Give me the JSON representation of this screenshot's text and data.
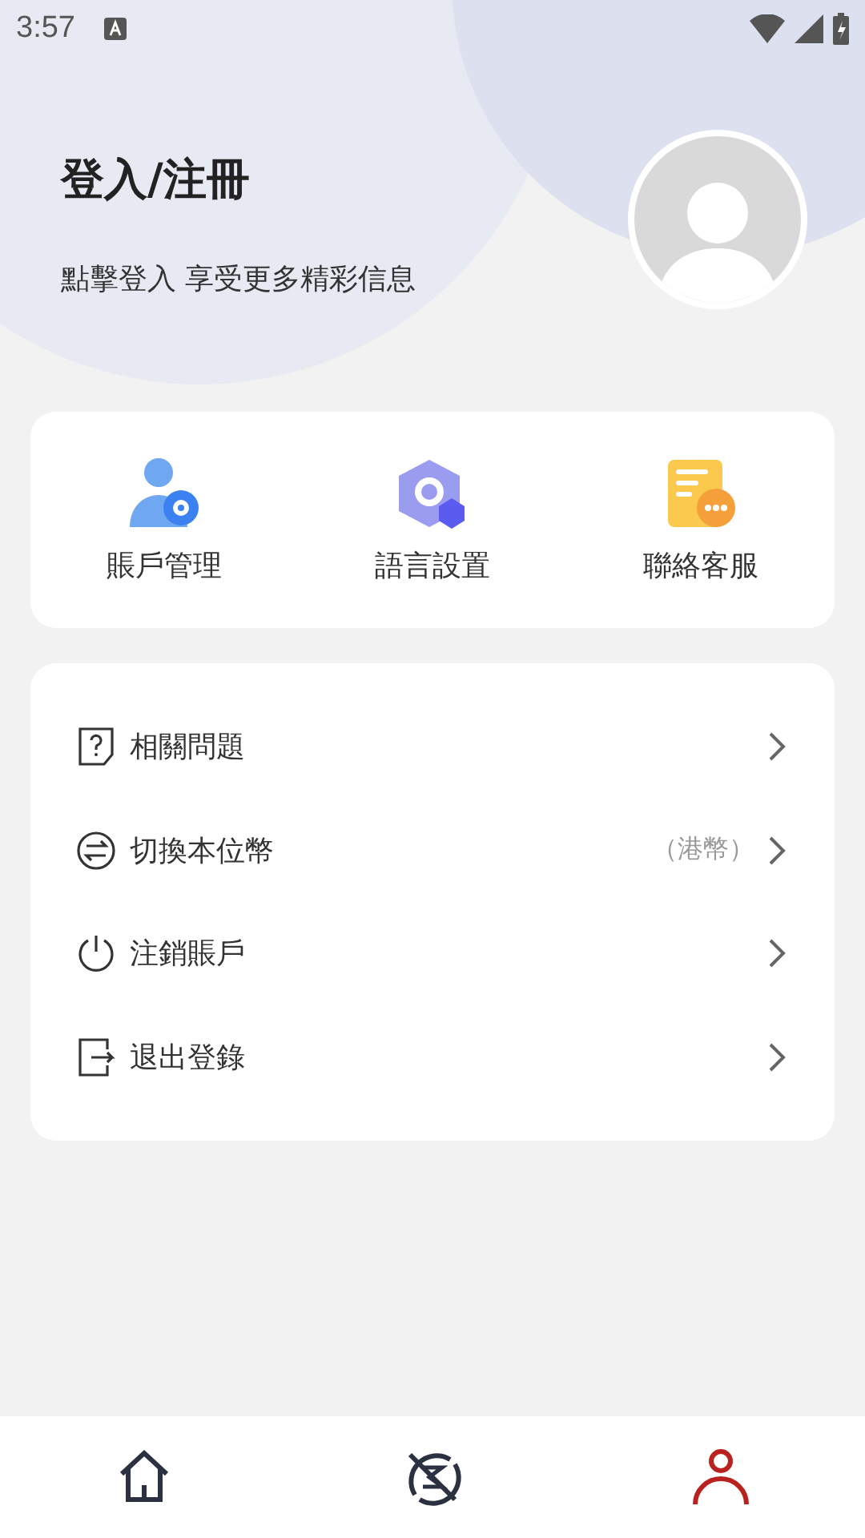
{
  "status_bar": {
    "time": "3:57"
  },
  "profile": {
    "title": "登入/注冊",
    "subtitle": "點擊登入 享受更多精彩信息"
  },
  "shortcuts": [
    {
      "label": "賬戶管理"
    },
    {
      "label": "語言設置"
    },
    {
      "label": "聯絡客服"
    }
  ],
  "menu": [
    {
      "label": "相關問題"
    },
    {
      "label": "切換本位幣",
      "value": "（港幣）"
    },
    {
      "label": "注銷賬戶"
    },
    {
      "label": "退出登錄"
    }
  ],
  "tabs": [
    {
      "selected": false
    },
    {
      "selected": false
    },
    {
      "selected": true
    }
  ]
}
